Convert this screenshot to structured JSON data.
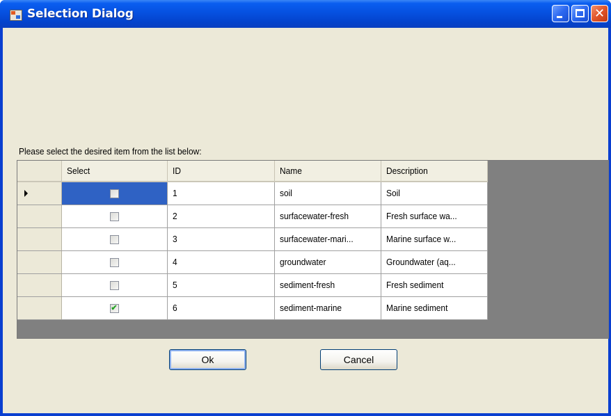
{
  "window": {
    "title": "Selection Dialog",
    "icon": "app-icon",
    "controls": [
      "minimize-icon",
      "maximize-icon",
      "close-icon"
    ]
  },
  "prompt": "Please select the desired item from the list below:",
  "grid": {
    "columns": [
      "Select",
      "ID",
      "Name",
      "Description"
    ],
    "rows": [
      {
        "selected": false,
        "id": "1",
        "name": "soil",
        "description": "Soil",
        "current": true
      },
      {
        "selected": false,
        "id": "2",
        "name": "surfacewater-fresh",
        "description": "Fresh surface wa...",
        "current": false
      },
      {
        "selected": false,
        "id": "3",
        "name": "surfacewater-mari...",
        "description": "Marine surface w...",
        "current": false
      },
      {
        "selected": false,
        "id": "4",
        "name": "groundwater",
        "description": "Groundwater (aq...",
        "current": false
      },
      {
        "selected": false,
        "id": "5",
        "name": "sediment-fresh",
        "description": "Fresh sediment",
        "current": false
      },
      {
        "selected": true,
        "id": "6",
        "name": "sediment-marine",
        "description": "Marine sediment",
        "current": false
      }
    ]
  },
  "buttons": {
    "ok": "Ok",
    "cancel": "Cancel"
  },
  "colors": {
    "titlebar": "#0651e0",
    "client": "#ece9d8",
    "current_cell": "#2f62c4",
    "grid_background": "#808080",
    "checkmark": "#21a121"
  }
}
